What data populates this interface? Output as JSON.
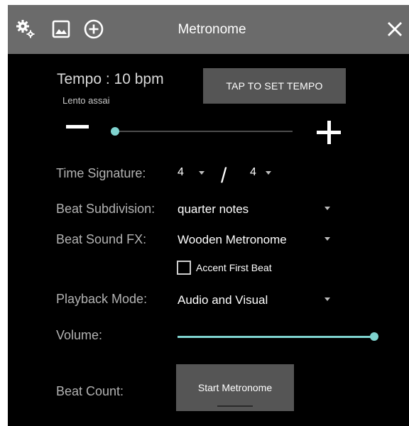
{
  "window": {
    "title": "Metronome",
    "icons": [
      "settings-gears-icon",
      "image-icon",
      "add-circle-icon",
      "close-icon"
    ]
  },
  "tempo": {
    "label": "Tempo :  10 bpm",
    "marking": "Lento assai",
    "tap_button": "TAP TO SET TEMPO",
    "slider_value_fraction": 0.02
  },
  "time_signature": {
    "label": "Time Signature:",
    "numerator": "4",
    "separator": "/",
    "denominator": "4"
  },
  "beat_subdivision": {
    "label": "Beat Subdivision:",
    "value": "quarter notes"
  },
  "beat_sound": {
    "label": "Beat Sound FX:",
    "value": "Wooden Metronome",
    "accent_label": "Accent First Beat",
    "accent_checked": false
  },
  "playback_mode": {
    "label": "Playback Mode:",
    "value": "Audio and Visual"
  },
  "volume": {
    "label": "Volume:",
    "level_fraction": 1.0
  },
  "beat_count": {
    "label": "Beat Count:",
    "start_button": "Start Metronome"
  },
  "colors": {
    "titlebar": "#6b6b6b",
    "background": "#000000",
    "accent": "#7fd3cf",
    "button": "#555555"
  }
}
